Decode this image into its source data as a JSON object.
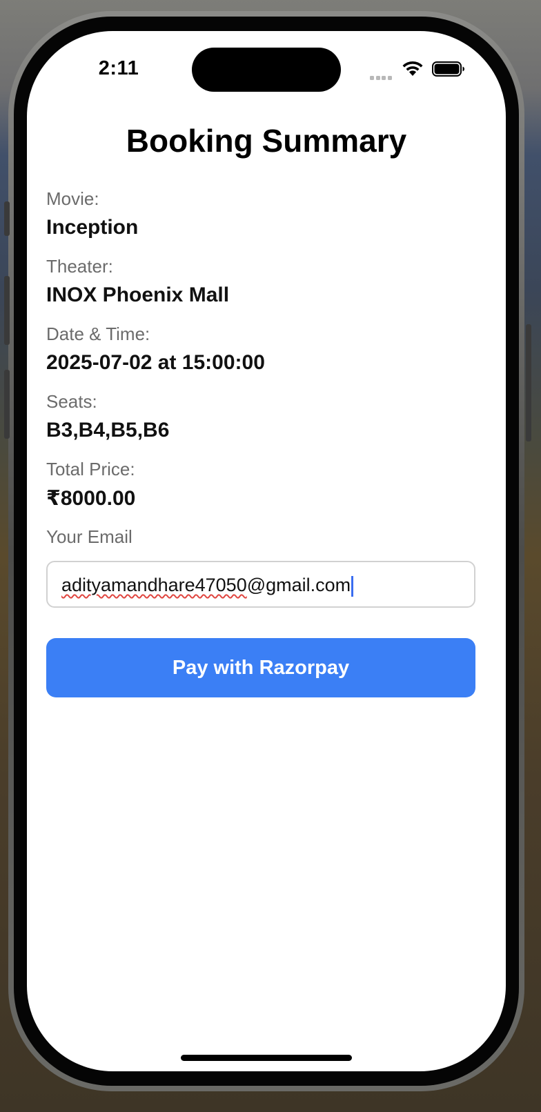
{
  "status_bar": {
    "time": "2:11",
    "icons": [
      "cellular-signal-icon",
      "wifi-icon",
      "battery-icon"
    ]
  },
  "page": {
    "title": "Booking Summary"
  },
  "summary": {
    "movie_label": "Movie:",
    "movie_value": "Inception",
    "theater_label": "Theater:",
    "theater_value": "INOX Phoenix Mall",
    "datetime_label": "Date & Time:",
    "datetime_value": "2025-07-02 at 15:00:00",
    "seats_label": "Seats:",
    "seats_value": "B3,B4,B5,B6",
    "price_label": "Total Price:",
    "price_value": "₹8000.00"
  },
  "email": {
    "label": "Your Email",
    "value_user": "adityamandhare47050",
    "value_domain": "@gmail.com",
    "value": "adityamandhare47050@gmail.com"
  },
  "actions": {
    "pay_label": "Pay with Razorpay"
  },
  "colors": {
    "accent": "#3b7ff5",
    "label_gray": "#6b6b6b",
    "spellcheck_red": "#e0453f",
    "caret_blue": "#3a6df0"
  }
}
